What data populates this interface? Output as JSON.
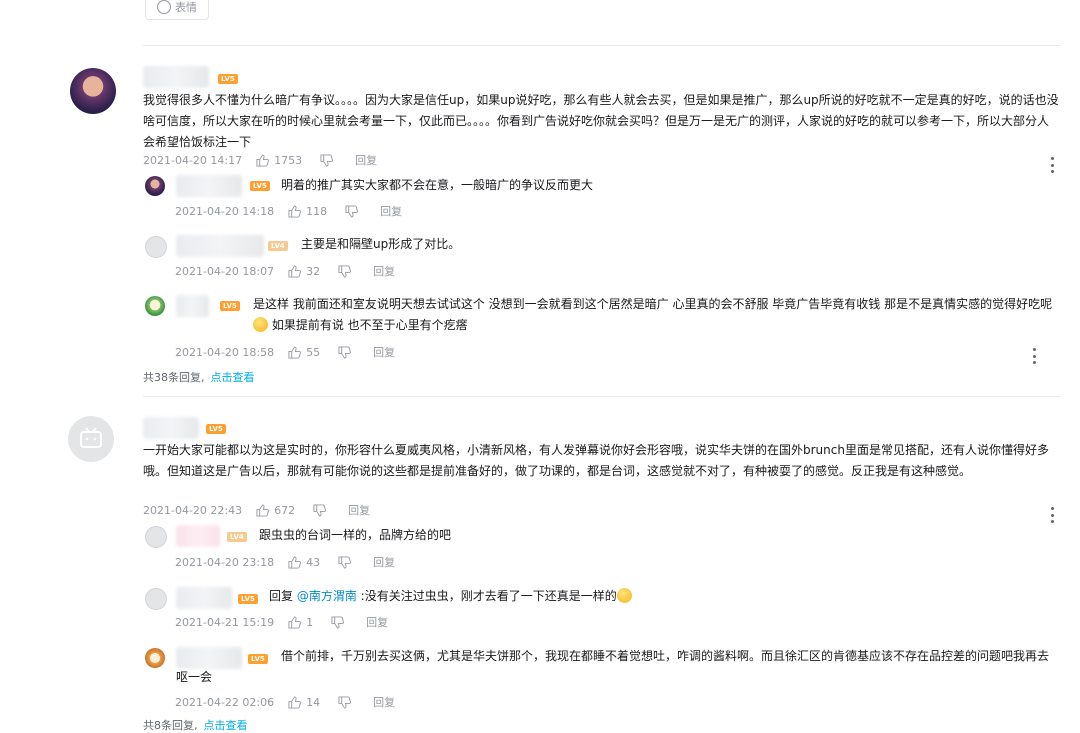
{
  "toolbar": {
    "emoji_label": "表情"
  },
  "comments": [
    {
      "level": "LV5",
      "text": "我觉得很多人不懂为什么暗广有争议。。。。因为大家是信任up，如果up说好吃，那么有些人就会去买，但是如果是推广，那么up所说的好吃就不一定是真的好吃，说的话也没啥可信度，所以大家在听的时候心里就会考量一下，仅此而已。。。。你看到广告说好吃你就会买吗？但是万一是无广的测评，人家说的好吃的就可以参考一下，所以大部分人会希望恰饭标注一下",
      "date": "2021-04-20 14:17",
      "likes": "1753",
      "reply_label": "回复",
      "replies": [
        {
          "level": "LV5",
          "text": "明着的推广其实大家都不会在意，一般暗广的争议反而更大",
          "date": "2021-04-20 14:18",
          "likes": "118",
          "reply_label": "回复"
        },
        {
          "level": "LV4",
          "text": "主要是和隔壁up形成了对比。",
          "date": "2021-04-20 18:07",
          "likes": "32",
          "reply_label": "回复"
        },
        {
          "level": "LV5",
          "text_a": "是这样 我前面还和室友说明天想去试试这个 没想到一会就看到这个居然是暗广 心里真的会不舒服 毕竟广告毕竟有收钱 那是不是真情实感的觉得好吃呢",
          "text_b": " 如果提前有说 也不至于心里有个疙瘩",
          "date": "2021-04-20 18:58",
          "likes": "55",
          "reply_label": "回复"
        }
      ],
      "replies_count_text": "共38条回复,",
      "view_more": "点击查看"
    },
    {
      "level": "LV5",
      "text": "一开始大家可能都以为这是实时的，你形容什么夏威夷风格，小清新风格，有人发弹幕说你好会形容哦，说实华夫饼的在国外brunch里面是常见搭配，还有人说你懂得好多哦。但知道这是广告以后，那就有可能你说的这些都是提前准备好的，做了功课的，都是台词，这感觉就不对了，有种被耍了的感觉。反正我是有这种感觉。",
      "date": "2021-04-20 22:43",
      "likes": "672",
      "reply_label": "回复",
      "replies": [
        {
          "level": "LV4",
          "text": "跟虫虫的台词一样的，品牌方给的吧",
          "date": "2021-04-20 23:18",
          "likes": "43",
          "reply_label": "回复"
        },
        {
          "level": "LV5",
          "prefix": "回复 ",
          "mention": "@南方渭南",
          "text": " :没有关注过虫虫，刚才去看了一下还真是一样的",
          "date": "2021-04-21 15:19",
          "likes": "1",
          "reply_label": "回复"
        },
        {
          "level": "LV5",
          "text": "借个前排，千万别去买这俩，尤其是华夫饼那个，我现在都睡不着觉想吐，咋调的酱料啊。而且徐汇区的肯德基应该不存在品控差的问题吧我再去呕一会",
          "date": "2021-04-22 02:06",
          "likes": "14",
          "reply_label": "回复"
        }
      ],
      "replies_count_text": "共8条回复,",
      "view_more": "点击查看"
    }
  ]
}
